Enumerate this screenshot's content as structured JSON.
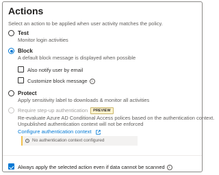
{
  "header": {
    "title": "Actions",
    "subtitle": "Select an action to be applied when user activity matches the policy."
  },
  "options": {
    "test": {
      "label": "Test",
      "description": "Monitor login activities",
      "selected": false
    },
    "block": {
      "label": "Block",
      "description": "A default block message is displayed when possible",
      "selected": true,
      "checkboxes": [
        {
          "label": "Also notify user by email",
          "checked": false
        },
        {
          "label": "Customize block message",
          "checked": false,
          "icon": "info-icon"
        }
      ]
    },
    "protect": {
      "label": "Protect",
      "description": "Apply sensitivity label to downloads & monitor all activities",
      "selected": false
    },
    "step_up": {
      "label": "Require step-up authentication",
      "badge": "PREVIEW",
      "description_line1": "Re-evaluate Azure AD Conditional Access polices based on the authentication context.",
      "description_line2": "Unpublished authentication context will not be enforced",
      "link_label": "Configure authentication context",
      "link_icon": "external-link-icon",
      "warning_text": "No authentication context configured",
      "warning_icon": "info-icon",
      "disabled": true
    }
  },
  "footer": {
    "always_apply_label": "Always apply the selected action even if data cannot be scanned",
    "always_apply_checked": true,
    "icon": "info-icon"
  },
  "colors": {
    "accent": "#0078d4",
    "warning_bar": "#f2c14e",
    "preview_badge_bg": "#fff4ce",
    "disabled_text": "#a19f9d"
  }
}
